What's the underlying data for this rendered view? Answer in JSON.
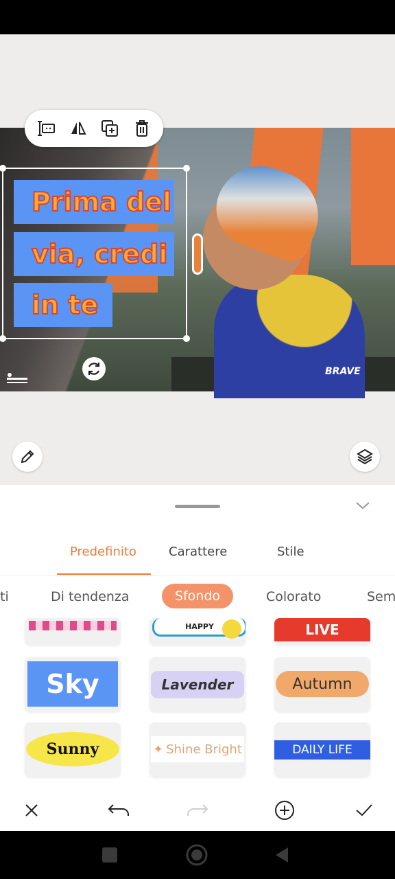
{
  "sticker": {
    "lines": [
      "Prima del",
      "via, credi",
      "in te"
    ]
  },
  "photo": {
    "brand": "BRAVE"
  },
  "tabs": [
    "Predefinito",
    "Carattere",
    "Stile"
  ],
  "categories": {
    "partial_left": "ti",
    "items": [
      "Di tendenza",
      "Sfondo",
      "Colorato"
    ],
    "partial_right": "Sem"
  },
  "stickers": {
    "row1": [
      "",
      "HAPPY",
      "LIVE"
    ],
    "row2": [
      "Sky",
      "Lavender",
      "Autumn"
    ],
    "row3": [
      "Sunny",
      "Shine Bright",
      "DAILY LIFE"
    ]
  },
  "colors": {
    "accent": "#f07a32",
    "chip": "#f4936a",
    "sticker_bg": "#5a95f5"
  }
}
